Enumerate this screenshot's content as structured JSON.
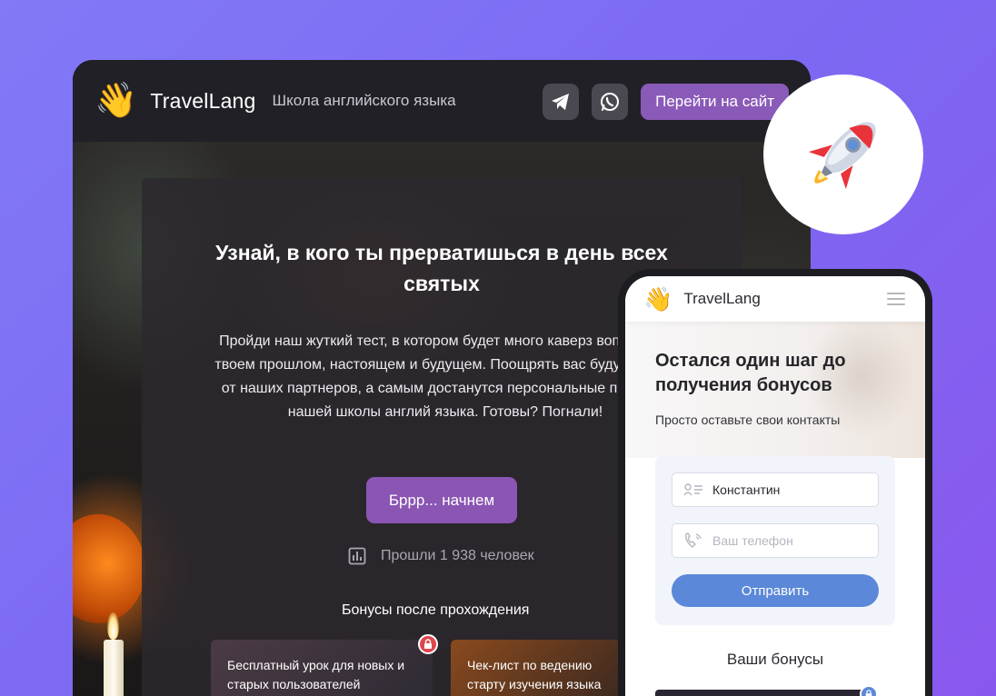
{
  "desktop": {
    "brand": "TravelLang",
    "tagline": "Школа английского языка",
    "site_button": "Перейти на сайт",
    "icons": [
      "telegram-icon",
      "whatsapp-icon"
    ],
    "hero": {
      "title": "Узнай, в кого ты прерватишься в день всех святых",
      "description": "Пройди наш жуткий тест, в котором будет много каверз вопросов о твоем прошлом, настоящем и будущем. Поощрять вас будут скидки от наших партнеров, а самым достанутся персональные призы от нашей школы англий языка. Готовы? Погнали!",
      "start_button": "Бррр... начнем",
      "stats": "Прошли 1 938 человек",
      "bonus_title": "Бонусы после прохождения",
      "bonuses": [
        {
          "label": "Бесплатный урок для новых и старых пользователей"
        },
        {
          "label": "Чек-лист по ведению старту изучения языка"
        }
      ]
    }
  },
  "mobile": {
    "brand": "TravelLang",
    "title": "Остался один шаг до получения бонусов",
    "subtitle": "Просто оставьте свои контакты",
    "name_value": "Константин",
    "phone_placeholder": "Ваш телефон",
    "submit": "Отправить",
    "bonus_title": "Ваши бонусы"
  },
  "colors": {
    "background": "#7c69f2",
    "accent_purple": "#8a55b3",
    "submit_blue": "#5b88d8"
  }
}
